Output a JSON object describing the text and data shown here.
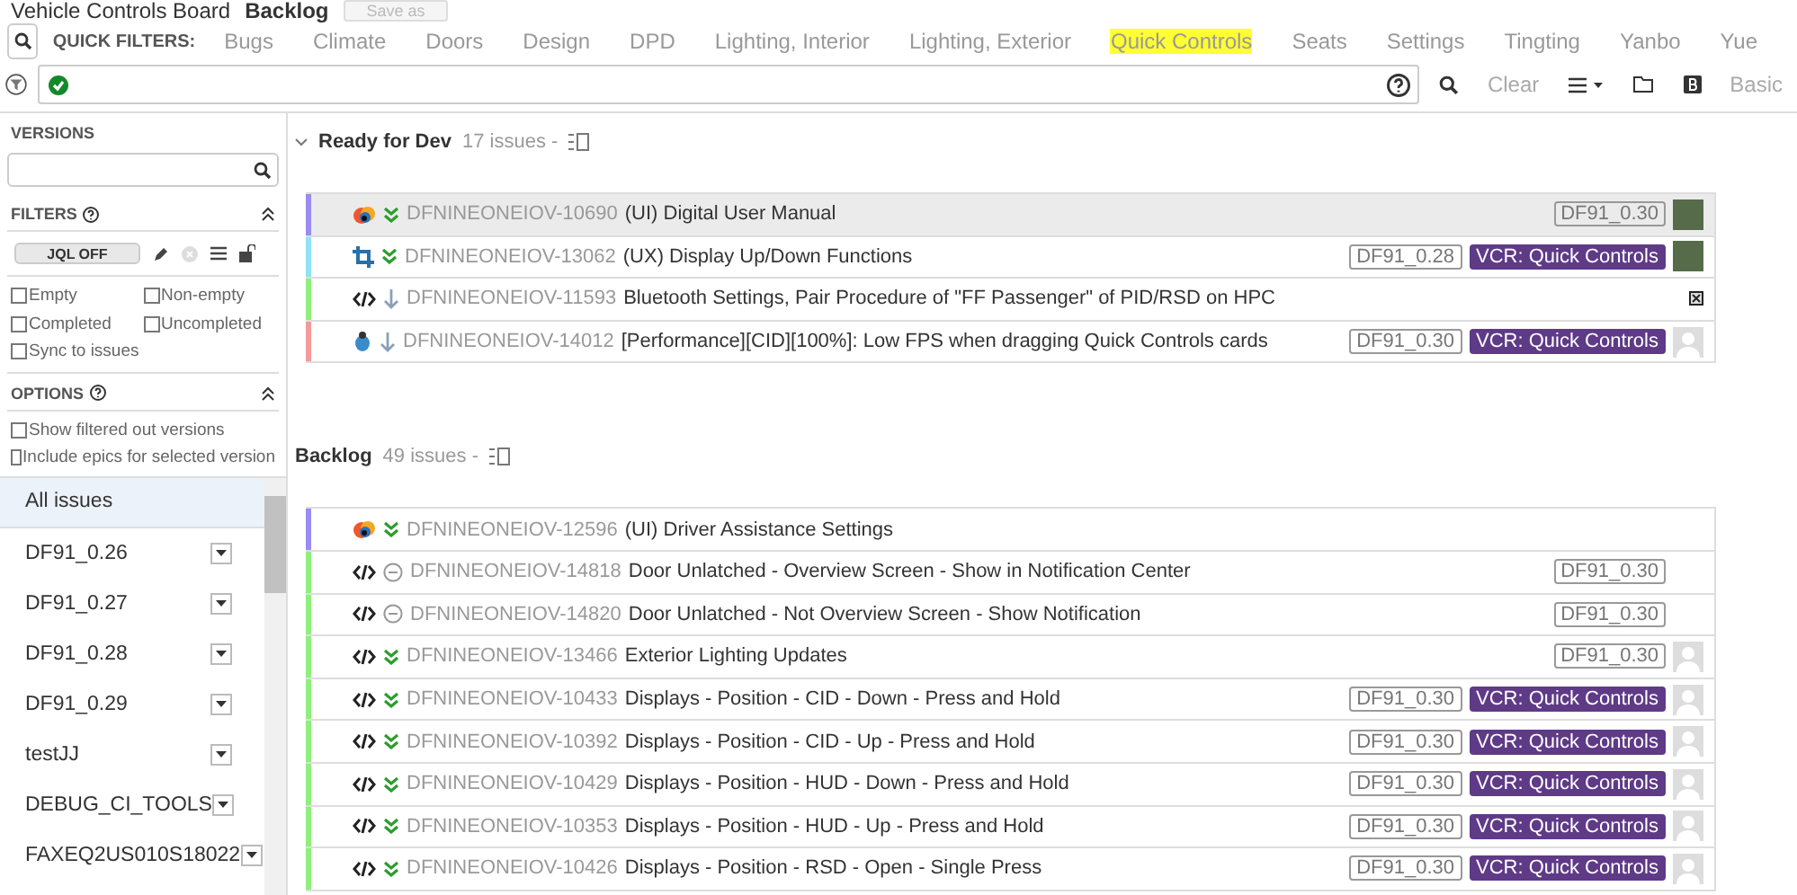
{
  "header": {
    "title": "Vehicle Controls Board",
    "subtitle": "Backlog",
    "save_button": "Save as"
  },
  "quick_filters": {
    "label": "QUICK FILTERS:",
    "items": [
      {
        "label": "Bugs",
        "highlighted": false
      },
      {
        "label": "Climate",
        "highlighted": false
      },
      {
        "label": "Doors",
        "highlighted": false
      },
      {
        "label": "Design",
        "highlighted": false
      },
      {
        "label": "DPD",
        "highlighted": false
      },
      {
        "label": "Lighting, Interior",
        "highlighted": false
      },
      {
        "label": "Lighting, Exterior",
        "highlighted": false
      },
      {
        "label": "Quick Controls",
        "highlighted": true
      },
      {
        "label": "Seats",
        "highlighted": false
      },
      {
        "label": "Settings",
        "highlighted": false
      },
      {
        "label": "Tingting",
        "highlighted": false
      },
      {
        "label": "Yanbo",
        "highlighted": false
      },
      {
        "label": "Yue",
        "highlighted": false
      }
    ]
  },
  "query_bar": {
    "clear": "Clear",
    "basic": "Basic"
  },
  "sidebar": {
    "versions_title": "VERSIONS",
    "filters_title": "FILTERS",
    "jql": "JQL OFF",
    "filter_checks": [
      {
        "label": "Empty",
        "checked": false
      },
      {
        "label": "Non-empty",
        "checked": false
      },
      {
        "label": "Completed",
        "checked": false
      },
      {
        "label": "Uncompleted",
        "checked": false
      },
      {
        "label": "Sync to issues",
        "checked": false
      }
    ],
    "options_title": "OPTIONS",
    "option_checks": [
      {
        "label": "Show filtered out versions",
        "checked": false
      },
      {
        "label": "Include epics for selected version",
        "checked": false
      }
    ],
    "versions": [
      {
        "label": "All issues",
        "selected": true
      },
      {
        "label": "DF91_0.26",
        "selected": false
      },
      {
        "label": "DF91_0.27",
        "selected": false
      },
      {
        "label": "DF91_0.28",
        "selected": false
      },
      {
        "label": "DF91_0.29",
        "selected": false
      },
      {
        "label": "testJJ",
        "selected": false
      },
      {
        "label": "DEBUG_CI_TOOLS",
        "selected": false
      },
      {
        "label": "FAXEQ2US010S18022",
        "selected": false
      }
    ]
  },
  "sections": [
    {
      "title": "Ready for Dev",
      "count": "17 issues -",
      "hovered": true,
      "issues": [
        {
          "type_icon": {
            "kind": "ui"
          },
          "priority_icon": {
            "kind": "highest"
          },
          "color": "#9a8cf0",
          "key": "DFNINEONEIOV-10690",
          "summary": "(UI) Digital User Manual",
          "version": "DF91_0.30",
          "selected": true,
          "avatar": {
            "kind": "photo"
          }
        },
        {
          "type_icon": {
            "kind": "ux"
          },
          "priority_icon": {
            "kind": "highest"
          },
          "color": "#8ee3f5",
          "key": "DFNINEONEIOV-13062",
          "summary": "(UX) Display Up/Down Functions",
          "version": "DF91_0.28",
          "epic": "VCR: Quick Controls",
          "selected": false,
          "avatar": {
            "kind": "photo"
          }
        },
        {
          "type_icon": {
            "kind": "code"
          },
          "priority_icon": {
            "kind": "low"
          },
          "color": "#8ef07a",
          "key": "DFNINEONEIOV-11593",
          "summary": "Bluetooth Settings, Pair Procedure of \"FF Passenger\" of PID/RSD on HPC",
          "selected": false,
          "avatar": {
            "kind": "broken"
          }
        },
        {
          "type_icon": {
            "kind": "bug"
          },
          "priority_icon": {
            "kind": "low"
          },
          "color": "#f59a9a",
          "key": "DFNINEONEIOV-14012",
          "summary": "[Performance][CID][100%]: Low FPS when dragging Quick Controls cards",
          "version": "DF91_0.30",
          "epic": "VCR: Quick Controls",
          "selected": false,
          "avatar": {
            "kind": "default"
          }
        }
      ]
    },
    {
      "title": "Backlog",
      "count": "49 issues -",
      "hovered": false,
      "issues": [
        {
          "type_icon": {
            "kind": "ui"
          },
          "priority_icon": {
            "kind": "highest"
          },
          "color": "#9a8cf0",
          "key": "DFNINEONEIOV-12596",
          "summary": "(UI) Driver Assistance Settings",
          "selected": false
        },
        {
          "type_icon": {
            "kind": "code"
          },
          "priority_icon": {
            "kind": "none"
          },
          "color": "#8ef07a",
          "key": "DFNINEONEIOV-14818",
          "summary": "Door Unlatched - Overview Screen - Show in Notification Center",
          "version": "DF91_0.30",
          "selected": false
        },
        {
          "type_icon": {
            "kind": "code"
          },
          "priority_icon": {
            "kind": "none"
          },
          "color": "#8ef07a",
          "key": "DFNINEONEIOV-14820",
          "summary": "Door Unlatched - Not Overview Screen - Show Notification",
          "version": "DF91_0.30",
          "selected": false
        },
        {
          "type_icon": {
            "kind": "code"
          },
          "priority_icon": {
            "kind": "highest"
          },
          "color": "#8ef07a",
          "key": "DFNINEONEIOV-13466",
          "summary": "Exterior Lighting Updates",
          "version": "DF91_0.30",
          "selected": false,
          "avatar": {
            "kind": "default"
          }
        },
        {
          "type_icon": {
            "kind": "code"
          },
          "priority_icon": {
            "kind": "highest"
          },
          "color": "#8ef07a",
          "key": "DFNINEONEIOV-10433",
          "summary": "Displays - Position - CID - Down - Press and Hold",
          "version": "DF91_0.30",
          "epic": "VCR: Quick Controls",
          "selected": false,
          "avatar": {
            "kind": "default"
          }
        },
        {
          "type_icon": {
            "kind": "code"
          },
          "priority_icon": {
            "kind": "highest"
          },
          "color": "#8ef07a",
          "key": "DFNINEONEIOV-10392",
          "summary": "Displays - Position - CID - Up - Press and Hold",
          "version": "DF91_0.30",
          "epic": "VCR: Quick Controls",
          "selected": false,
          "avatar": {
            "kind": "default"
          }
        },
        {
          "type_icon": {
            "kind": "code"
          },
          "priority_icon": {
            "kind": "highest"
          },
          "color": "#8ef07a",
          "key": "DFNINEONEIOV-10429",
          "summary": "Displays - Position - HUD - Down - Press and Hold",
          "version": "DF91_0.30",
          "epic": "VCR: Quick Controls",
          "selected": false,
          "avatar": {
            "kind": "default"
          }
        },
        {
          "type_icon": {
            "kind": "code"
          },
          "priority_icon": {
            "kind": "highest"
          },
          "color": "#8ef07a",
          "key": "DFNINEONEIOV-10353",
          "summary": "Displays - Position - HUD - Up - Press and Hold",
          "version": "DF91_0.30",
          "epic": "VCR: Quick Controls",
          "selected": false,
          "avatar": {
            "kind": "default"
          }
        },
        {
          "type_icon": {
            "kind": "code"
          },
          "priority_icon": {
            "kind": "highest"
          },
          "color": "#8ef07a",
          "key": "DFNINEONEIOV-10426",
          "summary": "Displays - Position - RSD - Open - Single Press",
          "version": "DF91_0.30",
          "epic": "VCR: Quick Controls",
          "selected": false,
          "avatar": {
            "kind": "default"
          }
        }
      ]
    }
  ]
}
